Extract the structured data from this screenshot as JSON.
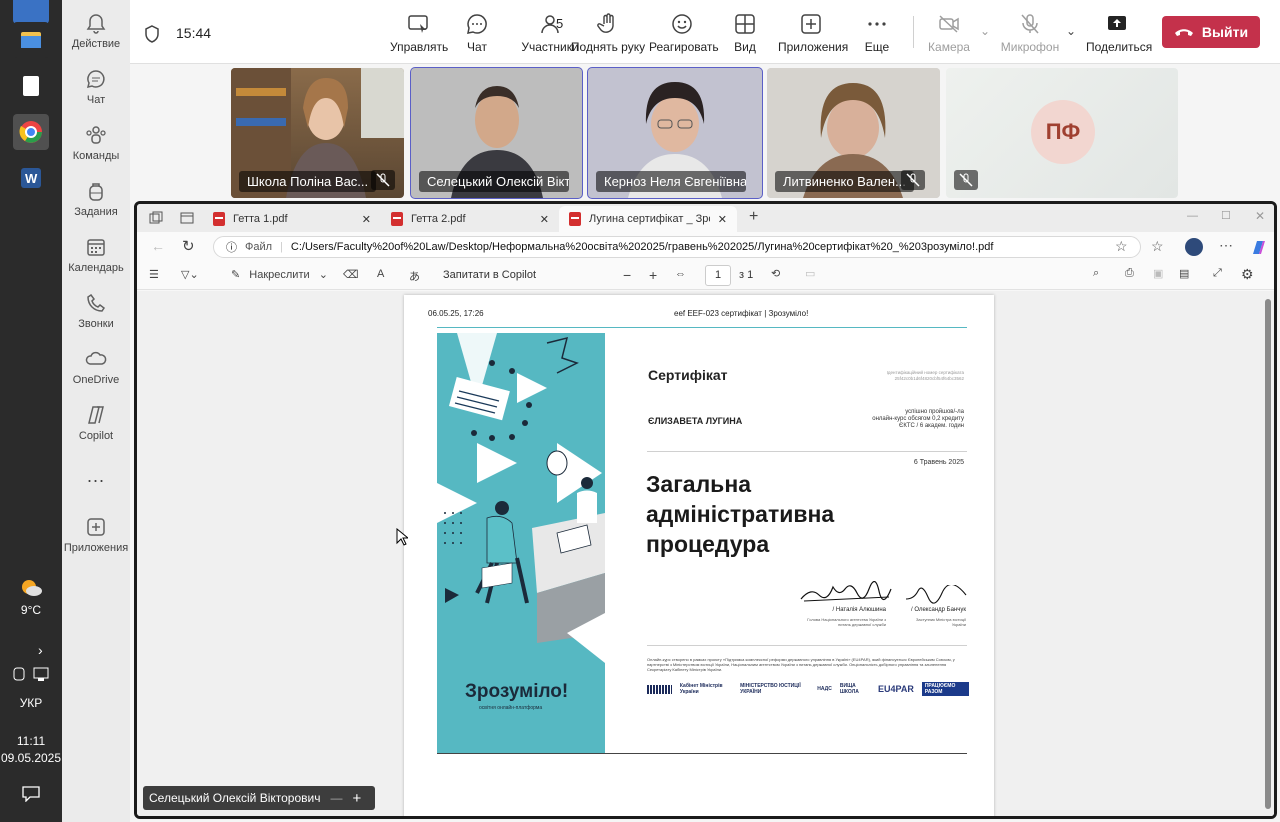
{
  "taskbar": {
    "weather_temp": "9°C",
    "language": "УКР",
    "time": "11:11",
    "date": "09.05.2025"
  },
  "rail": {
    "items": [
      {
        "label": "Действие",
        "icon": "bell-icon"
      },
      {
        "label": "Чат",
        "icon": "chat-icon"
      },
      {
        "label": "Команды",
        "icon": "teams-icon"
      },
      {
        "label": "Задания",
        "icon": "backpack-icon"
      },
      {
        "label": "Календарь",
        "icon": "calendar-icon"
      },
      {
        "label": "Звонки",
        "icon": "phone-icon"
      },
      {
        "label": "OneDrive",
        "icon": "cloud-icon"
      },
      {
        "label": "Copilot",
        "icon": "copilot-icon"
      },
      {
        "label": "...",
        "icon": "more-icon"
      },
      {
        "label": "Приложения",
        "icon": "add-apps-icon"
      }
    ]
  },
  "meeting": {
    "timer": "15:44",
    "participants_count": "5",
    "buttons": {
      "control": "Управлять",
      "chat": "Чат",
      "participants": "Участники",
      "raise_hand": "Поднять руку",
      "react": "Реагировать",
      "view": "Вид",
      "apps": "Приложения",
      "more": "Еще",
      "camera": "Камера",
      "mic": "Микрофон",
      "share": "Поделиться",
      "leave": "Выйти"
    },
    "tiles": [
      {
        "name": "Школа Поліна Вас..."
      },
      {
        "name": "Селецький Олексій Вікт..."
      },
      {
        "name": "Керноз Неля Євгеніївна"
      },
      {
        "name": "Литвиненко Вален..."
      },
      {
        "initials": "ПФ"
      }
    ],
    "presenter": "Селецький Олексій Вікторович"
  },
  "browser": {
    "tabs": [
      {
        "title": "Гетта 1.pdf"
      },
      {
        "title": "Гетта 2.pdf"
      },
      {
        "title": "Лугина сертифікат _ Зрозуміло! |"
      }
    ],
    "url_label": "Файл",
    "url": "C:/Users/Faculty%20of%20Law/Desktop/Неформальна%20освіта%202025/гравень%202025/Лугина%20сертифікат%20_%203розуміло!.pdf"
  },
  "pdf_toolbar": {
    "draw": "Накреслити",
    "ask_copilot": "Запитати в Copilot",
    "page": "1",
    "page_total": "з 1"
  },
  "certificate": {
    "header_left": "06.05.25, 17:26",
    "header_center": "eef EEF-023 сертифікат | Зрозуміло!",
    "title": "Сертифікат",
    "id_line1": "Ідентифікаційний номер сертифіката",
    "id_line2": "25f42c0b1d6f4820cbf54f64bc3562",
    "name": "ЄЛИЗАВЕТА ЛУГИНА",
    "completed1": "успішно пройшов/-ла",
    "completed2": "онлайн-курс обсягом 0,2 кредиту",
    "completed3": "ЄКТС / 6 академ. годин",
    "date": "6 Травень 2025",
    "course_line1": "Загальна",
    "course_line2": "адміністративна",
    "course_line3": "процедура",
    "signer1": "/ Наталія Алюшина",
    "signer1_role": "Голова Національного агентства України з питань державної служби",
    "signer2": "/ Олександр Банчук",
    "signer2_role": "Заступник Міністра юстиції України",
    "footer_text": "Онлайн-курс створено в рамках проєкту «Підтримка комплексної реформи державного управління в Україні» (EU4PAR), який фінансується Європейським Союзом, у партнерстві з Міністерством юстиції України, Національним агентством України з питань державної служби. Опціональність добірного управління та зачленення Секретаріату Кабінету Міністрів України.",
    "brand": "Зрозуміло!",
    "brand_sub": "освітня онлайн-платформа",
    "logos": [
      "Кабінет Міністрів України",
      "МІНІСТЕРСТВО ЮСТИЦІЇ УКРАЇНИ",
      "НАДС",
      "ВИЩА ШКОЛА",
      "EU4PAR",
      "ПРАЦЮЄМО РАЗОМ"
    ]
  }
}
